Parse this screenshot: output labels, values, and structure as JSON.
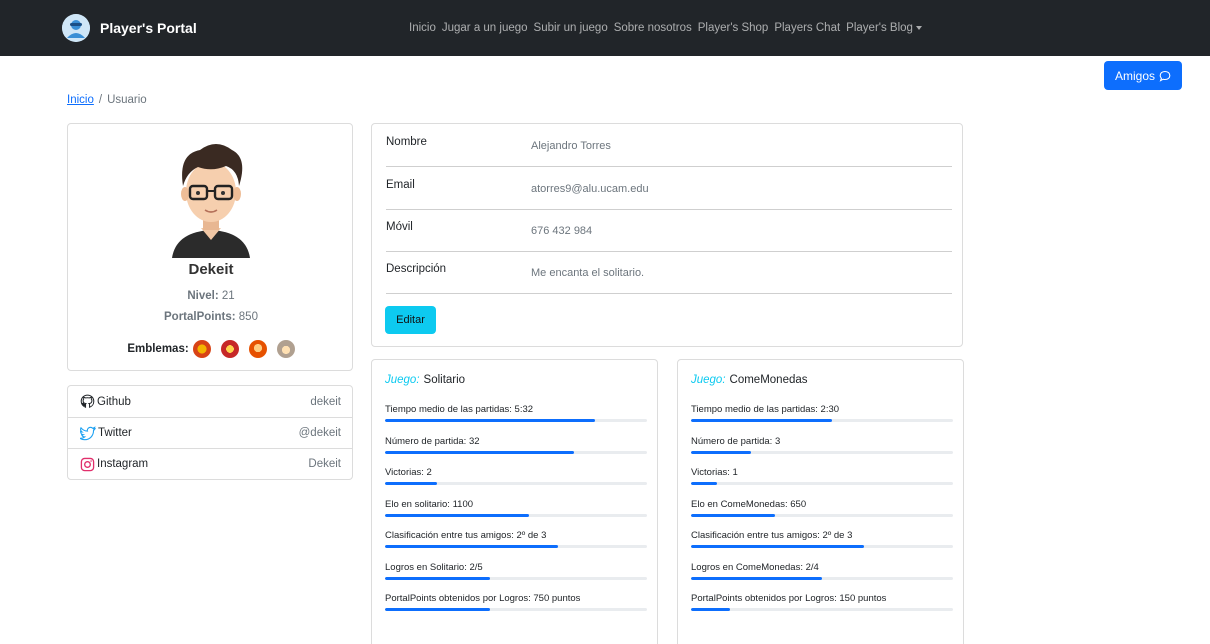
{
  "nav": {
    "brand": "Player's Portal",
    "links": [
      "Inicio",
      "Jugar a un juego",
      "Subir un juego",
      "Sobre nosotros",
      "Player's Shop",
      "Players Chat",
      "Player's Blog"
    ]
  },
  "amigos_label": "Amigos",
  "breadcrumb": {
    "home": "Inicio",
    "separator": "/",
    "current": "Usuario"
  },
  "profile": {
    "username": "Dekeit",
    "level_label": "Nivel:",
    "level": "21",
    "points_label": "PortalPoints:",
    "points": "850",
    "emblems_label": "Emblemas:"
  },
  "social": [
    {
      "name": "Github",
      "handle": "dekeit",
      "icon": "github-icon"
    },
    {
      "name": "Twitter",
      "handle": "@dekeit",
      "icon": "twitter-icon"
    },
    {
      "name": "Instagram",
      "handle": "Dekeit",
      "icon": "instagram-icon"
    }
  ],
  "details": [
    {
      "key": "Nombre",
      "value": "Alejandro Torres"
    },
    {
      "key": "Email",
      "value": "atorres9@alu.ucam.edu"
    },
    {
      "key": "Móvil",
      "value": "676 432 984"
    },
    {
      "key": "Descripción",
      "value": "Me encanta el solitario."
    }
  ],
  "edit_label": "Editar",
  "games": [
    {
      "label": "Juego:",
      "name": "Solitario",
      "stats": [
        {
          "text": "Tiempo medio de las partidas: 5:32",
          "progress": 0.8
        },
        {
          "text": "Número de partida: 32",
          "progress": 0.72
        },
        {
          "text": "Victorias: 2",
          "progress": 0.2
        },
        {
          "text": "Elo en solitario: 1100",
          "progress": 0.55
        },
        {
          "text": "Clasificación entre tus amigos: 2º de 3",
          "progress": 0.66
        },
        {
          "text": "Logros en Solitario: 2/5",
          "progress": 0.4
        },
        {
          "text": "PortalPoints obtenidos por Logros: 750 puntos",
          "progress": 0.4
        }
      ]
    },
    {
      "label": "Juego:",
      "name": "ComeMonedas",
      "stats": [
        {
          "text": "Tiempo medio de las partidas: 2:30",
          "progress": 0.54
        },
        {
          "text": "Número de partida: 3",
          "progress": 0.23
        },
        {
          "text": "Victorias: 1",
          "progress": 0.1
        },
        {
          "text": "Elo en ComeMonedas: 650",
          "progress": 0.32
        },
        {
          "text": "Clasificación entre tus amigos: 2º de 3",
          "progress": 0.66
        },
        {
          "text": "Logros en ComeMonedas: 2/4",
          "progress": 0.5
        },
        {
          "text": "PortalPoints obtenidos por Logros: 150 puntos",
          "progress": 0.15
        }
      ]
    }
  ],
  "colors": {
    "navbar": "#212529",
    "primary": "#0d6efd",
    "info": "#0dcaf0",
    "border": "#dcdcdc"
  }
}
